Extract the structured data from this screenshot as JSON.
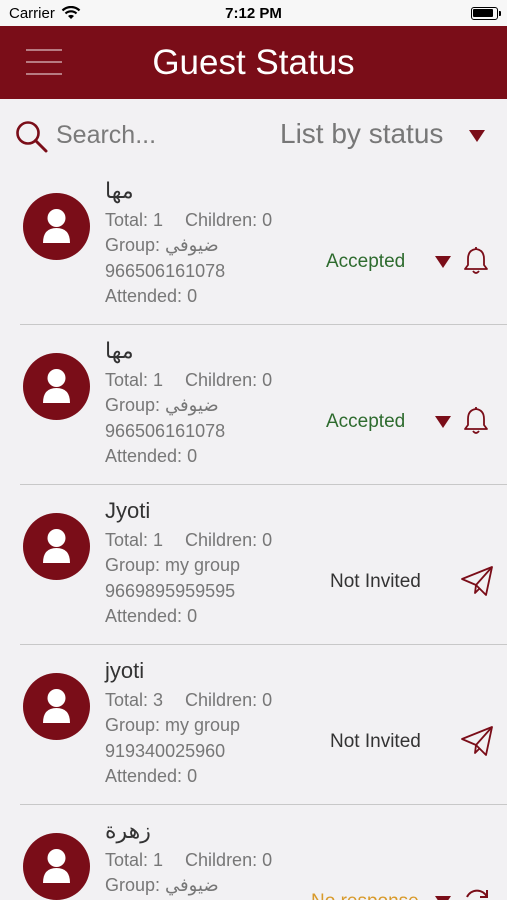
{
  "status_bar": {
    "carrier": "Carrier",
    "time": "7:12 PM"
  },
  "header": {
    "title": "Guest Status"
  },
  "search": {
    "placeholder": "Search...",
    "filter_label": "List by status"
  },
  "colors": {
    "primary": "#7a0d18",
    "accepted": "#2e6b2e",
    "no_response": "#d89a2a",
    "background": "#f2f1f3"
  },
  "guests": [
    {
      "name": "مها",
      "total": "Total: 1",
      "children": "Children: 0",
      "group": "Group: ضيوفي",
      "phone": "966506161078",
      "attended": "Attended: 0",
      "status": "Accepted",
      "action_icon": "bell-icon"
    },
    {
      "name": "مها",
      "total": "Total: 1",
      "children": "Children: 0",
      "group": "Group: ضيوفي",
      "phone": "966506161078",
      "attended": "Attended: 0",
      "status": "Accepted",
      "action_icon": "bell-icon"
    },
    {
      "name": "Jyoti",
      "total": "Total: 1",
      "children": "Children: 0",
      "group": "Group: my group",
      "phone": "9669895959595",
      "attended": "Attended: 0",
      "status": "Not Invited",
      "action_icon": "send-icon"
    },
    {
      "name": "jyoti",
      "total": "Total: 3",
      "children": "Children: 0",
      "group": "Group: my group",
      "phone": "919340025960",
      "attended": "Attended: 0",
      "status": "Not Invited",
      "action_icon": "send-icon"
    },
    {
      "name": "زهرة",
      "total": "Total: 1",
      "children": "Children: 0",
      "group": "Group: ضيوفي",
      "phone": "",
      "attended": "",
      "status": "No response",
      "action_icon": "refresh-icon"
    }
  ]
}
